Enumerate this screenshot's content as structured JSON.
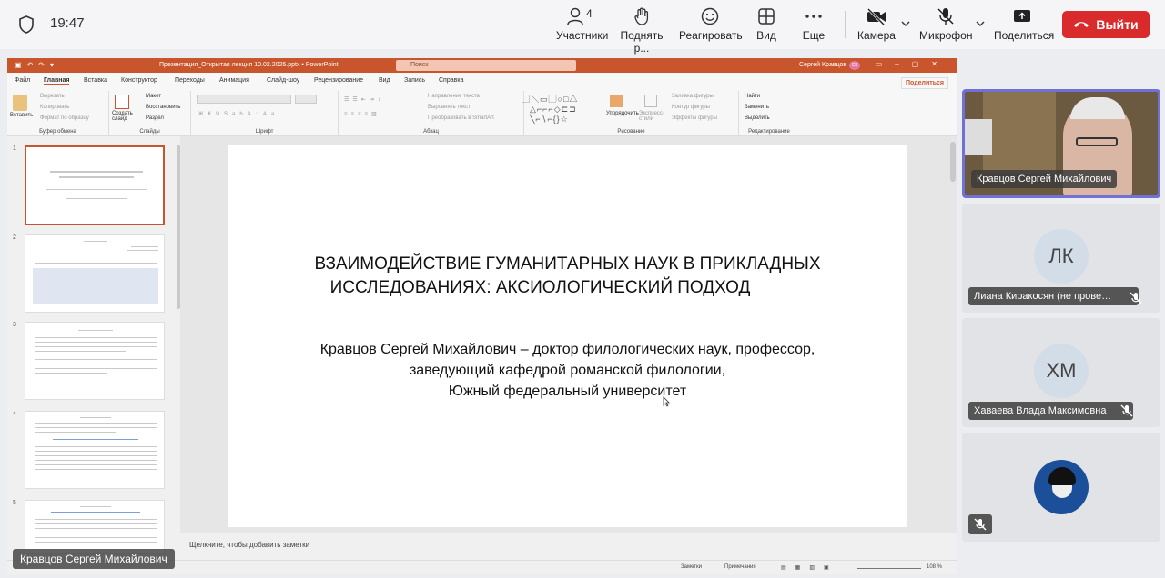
{
  "call": {
    "time": "19:47",
    "participants_count": "4",
    "toolbar": {
      "participants": "Участники",
      "raise_hand": "Поднять р...",
      "react": "Реагировать",
      "view": "Вид",
      "more": "Еще",
      "camera": "Камера",
      "mic": "Микрофон",
      "share": "Поделиться",
      "leave": "Выйти"
    },
    "self_name": "Кравцов Сергей Михайлович",
    "participants": [
      {
        "name": "Кравцов Сергей Михайлович",
        "initials": "",
        "muted": false
      },
      {
        "name": "Лиана Киракосян (не прове…",
        "initials": "ЛК",
        "muted": true
      },
      {
        "name": "Хаваева Влада Максимовна",
        "initials": "ХМ",
        "muted": true
      },
      {
        "name": "",
        "initials": "",
        "muted": true
      }
    ],
    "colors": {
      "leave": "#d92b2b",
      "active_border": "#6f71d9"
    }
  },
  "ppt": {
    "window_title": "Презентация_Открытая лекция 10.02.2025.pptx  •  PowerPoint",
    "search_placeholder": "Поиск",
    "user": "Сергей Кравцов",
    "user_initials": "СК",
    "tabs": [
      "Файл",
      "Главная",
      "Вставка",
      "Конструктор",
      "Переходы",
      "Анимация",
      "Слайд-шоу",
      "Рецензирование",
      "Вид",
      "Запись",
      "Справка"
    ],
    "share": "Поделиться",
    "ribbon": {
      "clipboard": {
        "label": "Буфер обмена",
        "paste": "Вставить",
        "cut": "Вырезать",
        "copy": "Копировать",
        "format": "Формат по образцу"
      },
      "slides": {
        "label": "Слайды",
        "new": "Создать слайд",
        "layout": "Макет",
        "reset": "Восстановить",
        "section": "Раздел"
      },
      "font": {
        "label": "Шрифт"
      },
      "paragraph": {
        "label": "Абзац",
        "direction": "Направление текста",
        "align": "Выровнять текст",
        "smartart": "Преобразовать в SmartArt"
      },
      "drawing": {
        "label": "Рисование",
        "arrange": "Упорядочить",
        "styles": "Экспресс-стили",
        "fill": "Заливка фигуры",
        "outline": "Контур фигуры",
        "effects": "Эффекты фигуры"
      },
      "editing": {
        "label": "Редактирование",
        "find": "Найти",
        "replace": "Заменить",
        "select": "Выделить"
      }
    },
    "slide_numbers": [
      "1",
      "2",
      "3",
      "4",
      "5"
    ],
    "slide": {
      "title_line1": "ВЗАИМОДЕЙСТВИЕ ГУМАНИТАРНЫХ  НАУК В ПРИКЛАДНЫХ",
      "title_line2": "ИССЛЕДОВАНИЯХ: АКСИОЛОГИЧЕСКИЙ ПОДХОД",
      "sub_line1": "Кравцов Сергей Михайлович – доктор филологических наук, профессор,",
      "sub_line2": "заведующий кафедрой романской филологии,",
      "sub_line3": "Южный федеральный университет"
    },
    "notes_placeholder": "Щелкните, чтобы добавить заметки",
    "status": {
      "notes": "Заметки",
      "comments": "Примечания",
      "zoom": "108 %"
    }
  }
}
